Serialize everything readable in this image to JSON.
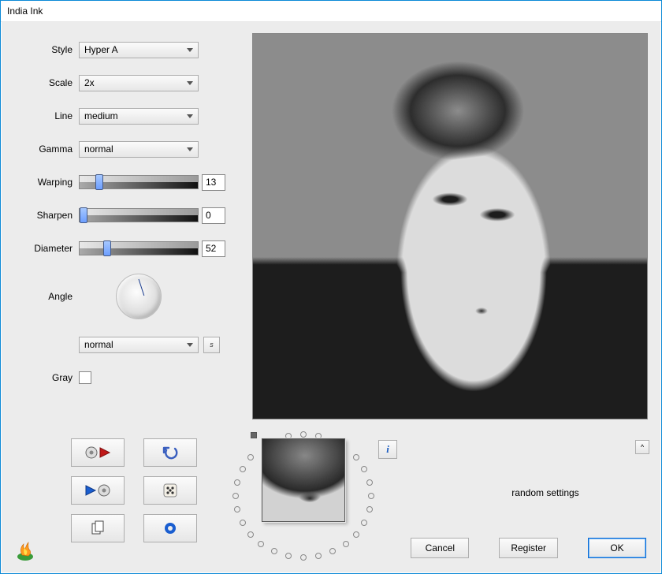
{
  "title": "India Ink",
  "controls": {
    "style_label": "Style",
    "style_value": "Hyper A",
    "scale_label": "Scale",
    "scale_value": "2x",
    "line_label": "Line",
    "line_value": "medium",
    "gamma_label": "Gamma",
    "gamma_value": "normal",
    "warping_label": "Warping",
    "warping_value": "13",
    "warping_percent": 13,
    "sharpen_label": "Sharpen",
    "sharpen_value": "0",
    "sharpen_percent": 0,
    "diameter_label": "Diameter",
    "diameter_value": "52",
    "diameter_percent": 52,
    "angle_label": "Angle",
    "mode_value": "normal",
    "swap_button": "s",
    "gray_label": "Gray"
  },
  "status": "random settings",
  "info_button": "i",
  "caret_button": "^",
  "buttons": {
    "cancel": "Cancel",
    "register": "Register",
    "ok": "OK"
  }
}
